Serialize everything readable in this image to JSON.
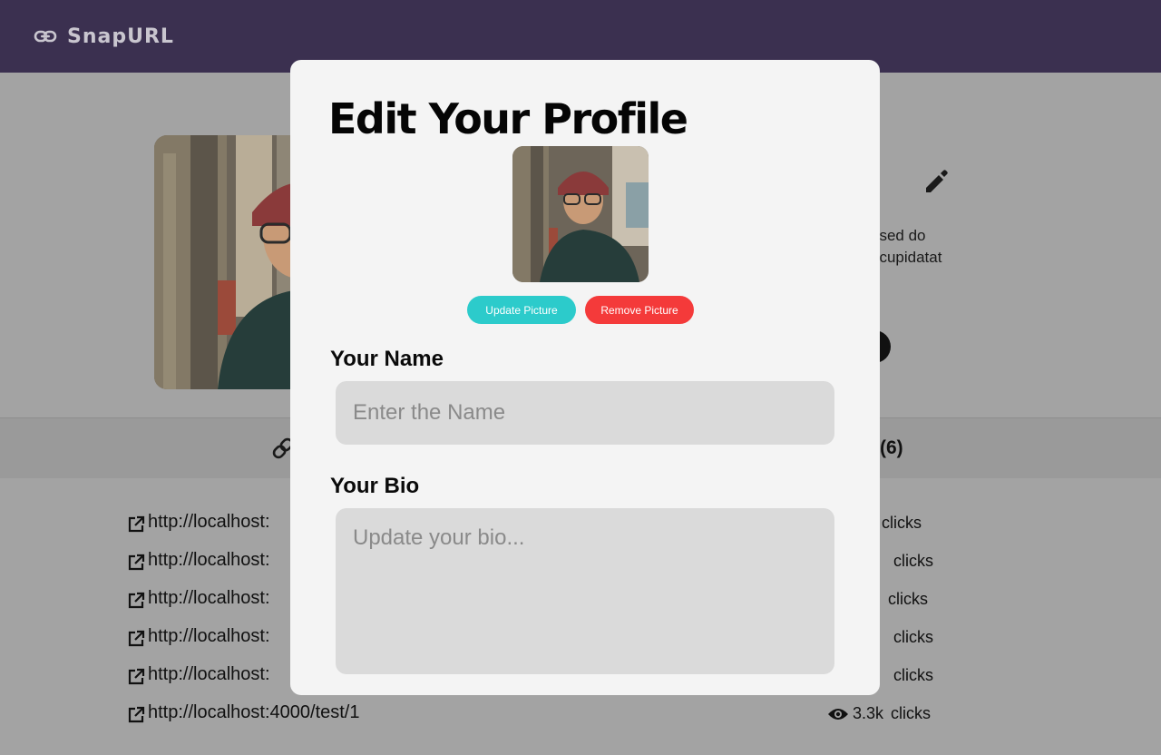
{
  "header": {
    "brand_title": "SnapURL",
    "brand_icon": "link-icon",
    "background_color": "#3b3050"
  },
  "profile": {
    "bio_snippet_line1": ", sed do",
    "bio_snippet_line2": "t cupidatat",
    "edit_icon": "pencil-icon"
  },
  "tabs": {
    "links_count_label": "(6)",
    "links_icon": "link-icon"
  },
  "links": [
    {
      "url": "http://localhost:",
      "clicks_value": "",
      "clicks_label": "clicks"
    },
    {
      "url": "http://localhost:",
      "clicks_value": "",
      "clicks_label": "clicks"
    },
    {
      "url": "http://localhost:",
      "clicks_value": "",
      "clicks_label": "clicks"
    },
    {
      "url": "http://localhost:",
      "clicks_value": "",
      "clicks_label": "clicks"
    },
    {
      "url": "http://localhost:",
      "clicks_value": "",
      "clicks_label": "clicks"
    },
    {
      "url": "http://localhost:4000/test/1",
      "clicks_value": "3.3k",
      "clicks_label": "clicks"
    }
  ],
  "modal": {
    "title": "Edit Your Profile",
    "update_picture_label": "Update Picture",
    "remove_picture_label": "Remove Picture",
    "name_label": "Your Name",
    "name_placeholder": "Enter the Name",
    "name_value": "",
    "bio_label": "Your Bio",
    "bio_placeholder": "Update your bio...",
    "bio_value": ""
  },
  "colors": {
    "update_button": "#2ccbcb",
    "remove_button": "#f43a3a",
    "overlay": "#a3a3a3",
    "modal_bg": "#f4f4f4"
  }
}
